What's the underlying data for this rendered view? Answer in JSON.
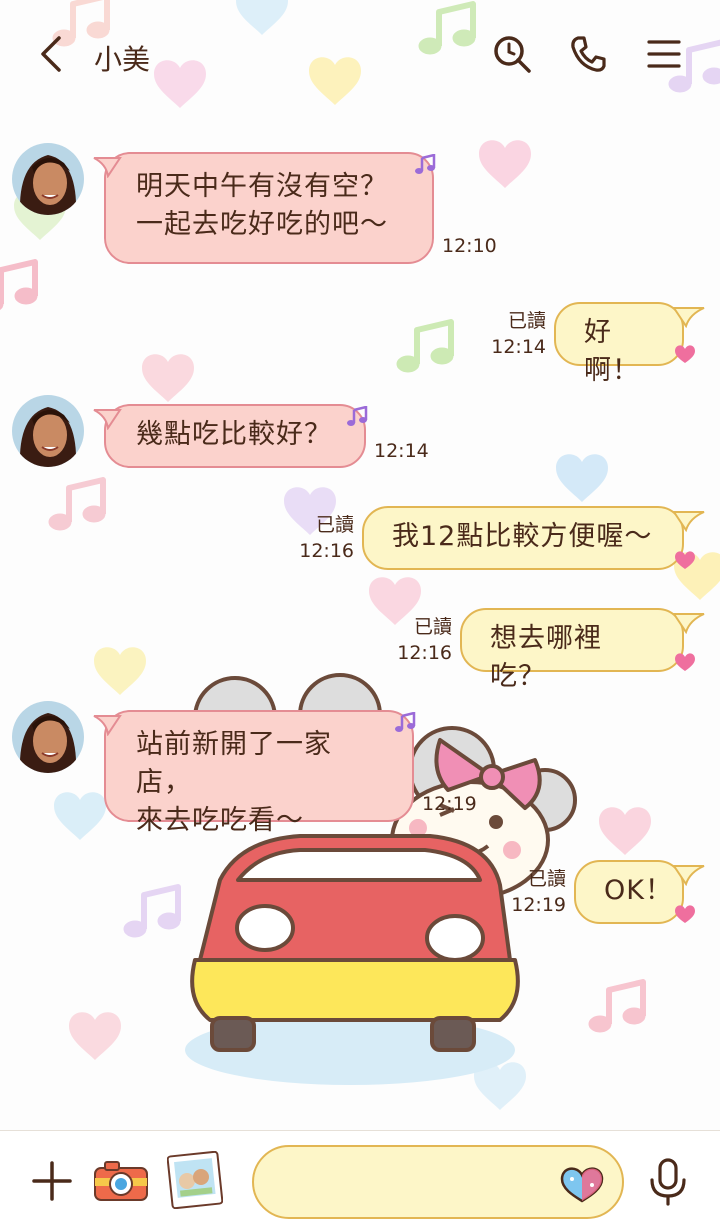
{
  "header": {
    "title": "小美",
    "icons": [
      "back-icon",
      "search-icon",
      "phone-icon",
      "menu-icon"
    ]
  },
  "messages": [
    {
      "id": "m1",
      "side": "in",
      "text": "明天中午有沒有空？\n一起去吃好吃的吧～",
      "time": "12:10"
    },
    {
      "id": "m2",
      "side": "out",
      "text": "好啊！",
      "read": "已讀",
      "time": "12:14"
    },
    {
      "id": "m3",
      "side": "in",
      "text": "幾點吃比較好？",
      "time": "12:14"
    },
    {
      "id": "m4",
      "side": "out",
      "text": "我12點比較方便喔～",
      "read": "已讀",
      "time": "12:16"
    },
    {
      "id": "m5",
      "side": "out",
      "text": "想去哪裡吃？",
      "read": "已讀",
      "time": "12:16"
    },
    {
      "id": "m6",
      "side": "in",
      "text": "站前新開了一家店，\n來去吃吃看～",
      "time": "12:19"
    },
    {
      "id": "m7",
      "side": "out",
      "text": "OK！",
      "read": "已讀",
      "time": "12:19"
    }
  ],
  "footer": {
    "icons": [
      "plus-icon",
      "camera-icon",
      "photo-icon",
      "heart-icon",
      "microphone-icon"
    ],
    "input_value": ""
  },
  "colors": {
    "incoming_bubble": "#fbd2cc",
    "incoming_border": "#e48c93",
    "outgoing_bubble": "#fdf6c8",
    "outgoing_border": "#e2b653",
    "text": "#4a2a1a"
  }
}
